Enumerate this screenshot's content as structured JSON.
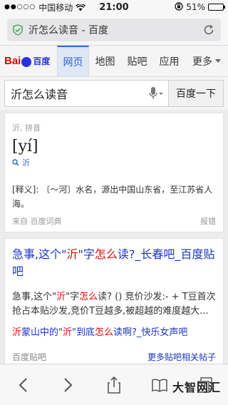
{
  "status": {
    "carrier": "中国移动",
    "time": "21:00",
    "battery": "51%",
    "battery_level": 0.51
  },
  "urlbar": {
    "title": "沂怎么读音 - 百度"
  },
  "header": {
    "logo_bai": "Bai",
    "logo_du": "百度",
    "tabs": [
      {
        "label": "网页",
        "active": true
      },
      {
        "label": "地图"
      },
      {
        "label": "贴吧"
      },
      {
        "label": "应用"
      },
      {
        "label": "更多"
      }
    ]
  },
  "search": {
    "query": "沂怎么读音",
    "button": "百度一下"
  },
  "dict": {
    "head": "沂, 拼音",
    "pinyin": "[yí]",
    "audio_label": "沂",
    "definition": "[释义]: 〔～河〕水名，源出中国山东省，至江苏省人海。",
    "source": "来自 百度词典",
    "report": "报错"
  },
  "result": {
    "title_a": "急事,这个\"",
    "title_b": "沂",
    "title_c": "\"字",
    "title_d": "怎么",
    "title_e": "读?_长春吧_百度贴吧",
    "abs_a": "急事,这个\"",
    "abs_b": "沂",
    "abs_c": "\"字",
    "abs_d": "怎么",
    "abs_e": "读? () 竞价沙发:- + T豆首次抢占本贴沙发,竞价T豆越多,被超越的难度越大...",
    "sub_a": "沂",
    "sub_b": "蒙山中的\"",
    "sub_c": "沂",
    "sub_d": "\"到底",
    "sub_e": "怎么",
    "sub_f": "读啊?_快乐女声吧",
    "foot_left": "百度贴吧",
    "foot_right": "更多贴吧相关帖子"
  },
  "watermark": "大智网汇"
}
